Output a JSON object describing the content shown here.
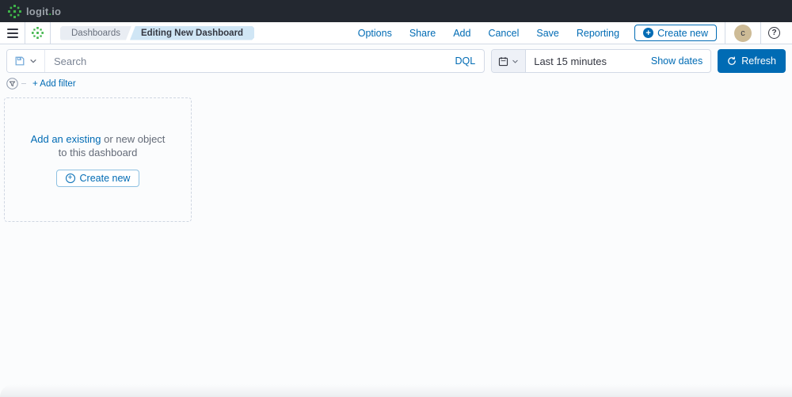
{
  "topbar": {
    "logo_text_main": "logit",
    "logo_text_dot": ".",
    "logo_text_tld": "io"
  },
  "nav": {
    "breadcrumbs": [
      {
        "label": "Dashboards"
      },
      {
        "label": "Editing New Dashboard"
      }
    ],
    "links": [
      "Options",
      "Share",
      "Add",
      "Cancel",
      "Save",
      "Reporting"
    ],
    "create_new_label": "Create new",
    "avatar_initial": "c",
    "help_glyph": "?"
  },
  "querybar": {
    "search_placeholder": "Search",
    "dql_label": "DQL",
    "time_range": "Last 15 minutes",
    "show_dates_label": "Show dates",
    "refresh_label": "Refresh"
  },
  "filterbar": {
    "add_filter_label": "+ Add filter"
  },
  "panel": {
    "line1_link": "Add an existing",
    "line1_rest": " or new object",
    "line2": "to this dashboard",
    "create_new_label": "Create new"
  },
  "icons": {
    "plus": "+"
  },
  "colors": {
    "primary": "#006BB4",
    "topbar_bg": "#232830",
    "logo_green": "#3eb449",
    "breadcrumb_active_bg": "#d0e6f5",
    "breadcrumb_bg": "#e9edf3",
    "avatar_bg": "#cdbb96",
    "refresh_bg": "#006BB4"
  }
}
